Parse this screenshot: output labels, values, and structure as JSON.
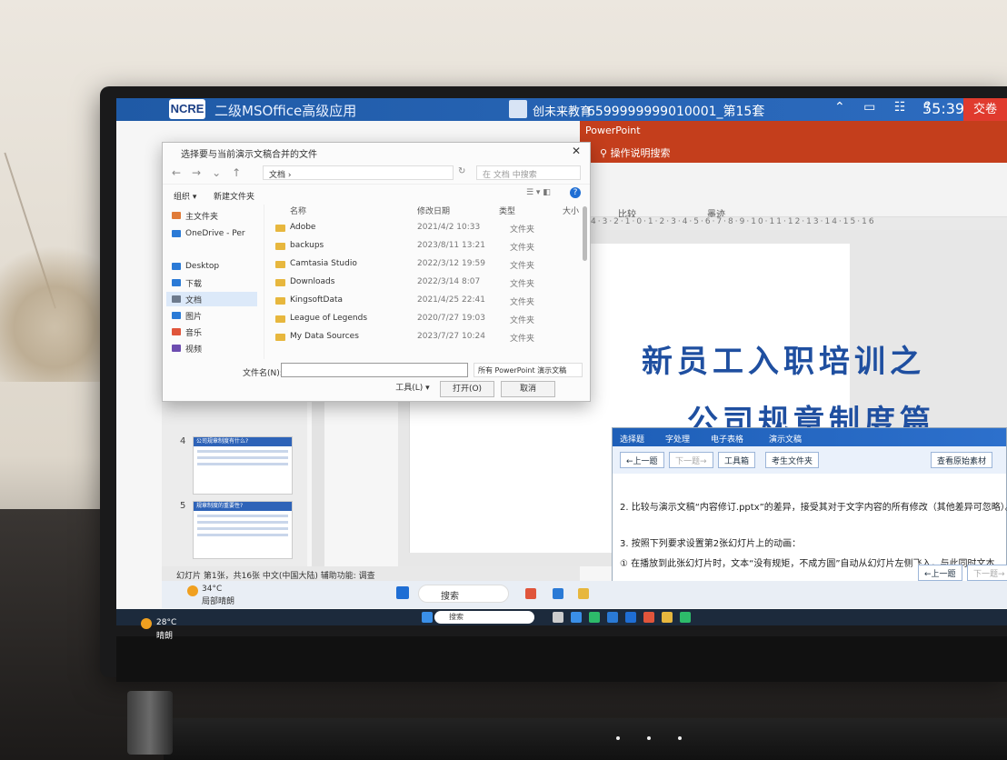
{
  "exam": {
    "title": "二级MSOffice高级应用",
    "logo": "NCRE",
    "brand": "创未来教育",
    "exam_no": "6599999999010001_第15套",
    "controls": "⌃ ▭ ☷ ?",
    "timer": "55:39",
    "submit": "交卷"
  },
  "ppt": {
    "window_title": "PowerPoint",
    "tell_me": "操作说明搜索",
    "ribbon_label_compare": "比较",
    "ribbon_label_comment": "墨迹",
    "slide_title_1": "新员工入职培训之",
    "slide_title_2": "公司规章制度篇",
    "status": "幻灯片 第1张，共16张   中文(中国大陆)   辅助功能: 调查",
    "thumb4_title": "公司规章制度有什么?",
    "thumb5_title": "规章制度的重要性?",
    "thumb4_num": "4",
    "thumb5_num": "5"
  },
  "dialog": {
    "title": "选择要与当前演示文稿合并的文件",
    "breadcrumb": "文档 ›",
    "search_placeholder": "在 文档 中搜索",
    "organize": "组织 ▾",
    "new_folder": "新建文件夹",
    "col_name": "名称",
    "col_date": "修改日期",
    "col_type": "类型",
    "col_size": "大小",
    "nav": [
      {
        "label": "主文件夹",
        "color": "#e07b39"
      },
      {
        "label": "OneDrive - Per",
        "color": "#2a7ad6"
      },
      {
        "label": "Desktop",
        "color": "#2a7ad6"
      },
      {
        "label": "下载",
        "color": "#2a7ad6"
      },
      {
        "label": "文档",
        "color": "#6d7a8c"
      },
      {
        "label": "图片",
        "color": "#2a7ad6"
      },
      {
        "label": "音乐",
        "color": "#e0553b"
      },
      {
        "label": "视频",
        "color": "#6d4db0"
      }
    ],
    "files": [
      {
        "name": "Adobe",
        "date": "2021/4/2 10:33",
        "type": "文件夹"
      },
      {
        "name": "backups",
        "date": "2023/8/11 13:21",
        "type": "文件夹"
      },
      {
        "name": "Camtasia Studio",
        "date": "2022/3/12 19:59",
        "type": "文件夹"
      },
      {
        "name": "Downloads",
        "date": "2022/3/14 8:07",
        "type": "文件夹"
      },
      {
        "name": "KingsoftData",
        "date": "2021/4/25 22:41",
        "type": "文件夹"
      },
      {
        "name": "League of Legends",
        "date": "2020/7/27 19:03",
        "type": "文件夹"
      },
      {
        "name": "My Data Sources",
        "date": "2023/7/27 10:24",
        "type": "文件夹"
      }
    ],
    "filename_label": "文件名(N):",
    "filename_value": "",
    "filetype": "所有 PowerPoint 演示文稿",
    "tools": "工具(L) ▾",
    "open": "打开(O)",
    "cancel": "取消"
  },
  "helper": {
    "tabs": [
      "选择题",
      "字处理",
      "电子表格",
      "演示文稿"
    ],
    "prev": "←上一题",
    "next": "下一题→",
    "toolbox": "工具箱",
    "folder": "考生文件夹",
    "view_original": "查看原始素材",
    "task2": "2. 比较与演示文稿“内容修订.pptx”的差异，接受其对于文字内容的所有修改（其他差异可忽略）。",
    "task3": "3. 按照下列要求设置第2张幻灯片上的动画：",
    "task3_1": "① 在播放到此张幻灯片时，文本“没有规矩，不成方圆”自动从幻灯片左侧飞入，与此同时文本",
    "prev_bottom": "←上一题",
    "next_bottom": "下一题→"
  },
  "taskbar": {
    "weather_temp": "34°C",
    "weather_desc": "局部晴朗",
    "search": "搜索",
    "outer_search": "搜索",
    "left_temp": "28°C",
    "left_desc": "晴朗"
  }
}
